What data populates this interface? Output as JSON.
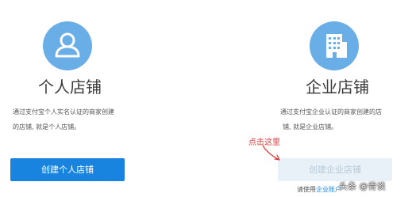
{
  "personal": {
    "icon": "person-icon",
    "title": "个人店铺",
    "desc_line1": "通过支付宝个人实名认证的商家创建",
    "desc_line2": "的店铺, 就是个人店铺。",
    "button_label": "创建个人店铺"
  },
  "business": {
    "icon": "building-icon",
    "title": "企业店铺",
    "desc_line1": "通过支付宝企业认证的商家创建的店",
    "desc_line2": "铺, 就是企业店铺。",
    "button_label": "创建企业店铺",
    "note_prefix": "请使用",
    "note_link": "企业账户"
  },
  "annotation": {
    "text": "点击这里",
    "color": "#d93a3a"
  },
  "watermark": "头条 @青谈",
  "colors": {
    "icon_circle": "#6aaee8",
    "primary_button": "#1984e0",
    "disabled_button": "#e8f1f8"
  }
}
